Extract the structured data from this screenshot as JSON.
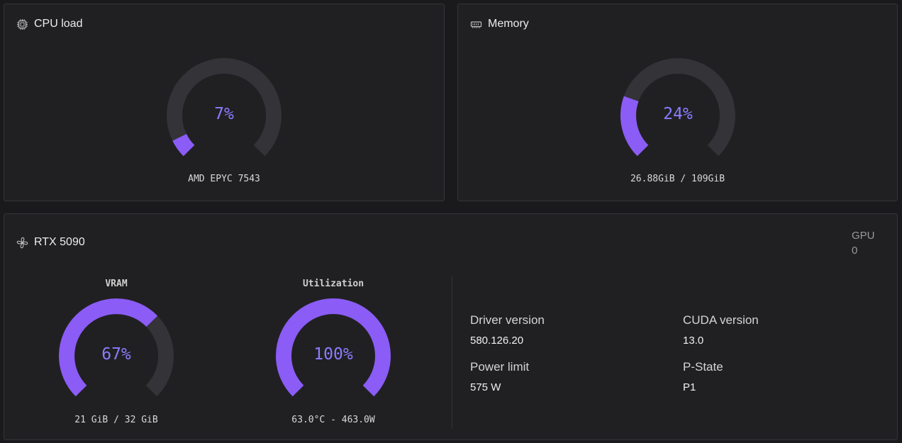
{
  "cpu": {
    "title": "CPU load",
    "icon": "cpu-chip-icon",
    "percent": 7,
    "percent_label": "7%",
    "model": "AMD EPYC 7543"
  },
  "memory": {
    "title": "Memory",
    "icon": "memory-module-icon",
    "percent": 24,
    "percent_label": "24%",
    "usage": "26.88GiB / 109GiB"
  },
  "gpu": {
    "title": "RTX 5090",
    "icon": "gpu-fan-icon",
    "index_label": "GPU",
    "index_value": "0",
    "vram": {
      "label": "VRAM",
      "percent": 67,
      "percent_label": "67%",
      "caption": "21 GiB / 32 GiB"
    },
    "utilization": {
      "label": "Utilization",
      "percent": 100,
      "percent_label": "100%",
      "caption": "63.0°C - 463.0W"
    },
    "info": {
      "driver_label": "Driver version",
      "driver_value": "580.126.20",
      "cuda_label": "CUDA version",
      "cuda_value": "13.0",
      "power_label": "Power limit",
      "power_value": "575 W",
      "pstate_label": "P-State",
      "pstate_value": "P1"
    }
  },
  "colors": {
    "accent": "#8b5cf6",
    "track": "#333338",
    "value_text": "#8b7cff"
  }
}
